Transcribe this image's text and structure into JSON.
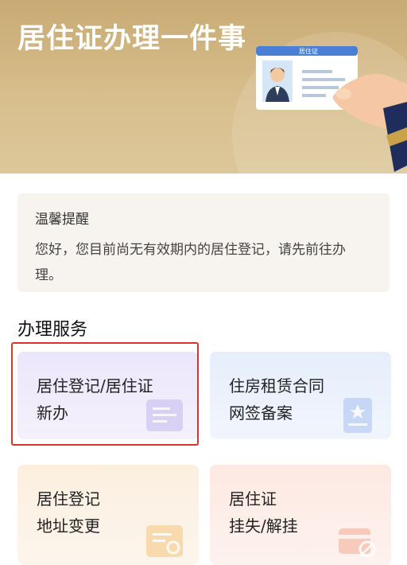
{
  "banner": {
    "title": "居住证办理一件事",
    "card_label": "居住证"
  },
  "notice": {
    "title": "温馨提醒",
    "text": "您好，您目前尚无有效期内的居住登记，请先前往办理。"
  },
  "services": {
    "section_title": "办理服务",
    "items": [
      {
        "line1": "居住登记/居住证",
        "line2": "新办",
        "icon": "id-card-icon"
      },
      {
        "line1": "住房租赁合同",
        "line2": "网签备案",
        "icon": "contract-icon"
      },
      {
        "line1": "居住登记",
        "line2": "地址变更",
        "icon": "address-change-icon"
      },
      {
        "line1": "居住证",
        "line2": "挂失/解挂",
        "icon": "card-disabled-icon"
      }
    ]
  },
  "colors": {
    "banner": "#c8aa73",
    "highlight": "#d9332b"
  }
}
